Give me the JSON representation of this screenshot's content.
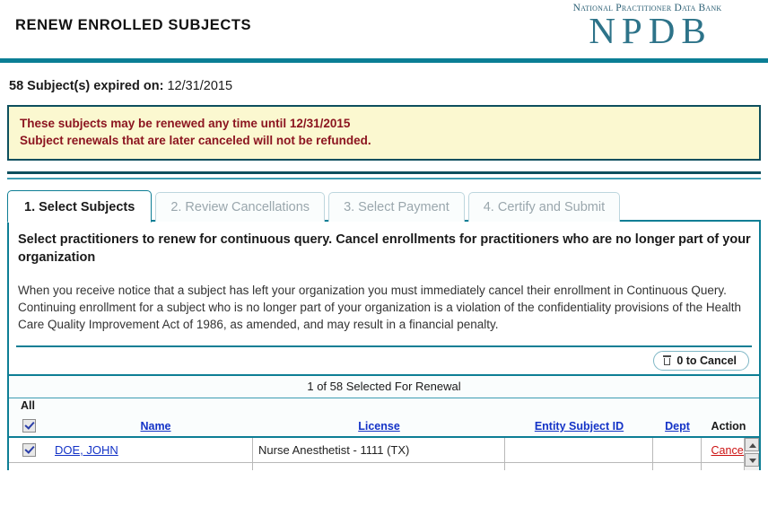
{
  "header": {
    "page_title": "RENEW ENROLLED SUBJECTS",
    "logo_subtitle": "National Practitioner Data Bank",
    "logo_main": "NPDB",
    "accent_color": "#0b7e95"
  },
  "summary": {
    "expired_label": "58 Subject(s) expired on:",
    "expired_date": "12/31/2015"
  },
  "warning": {
    "line1": "These subjects may be renewed any time until 12/31/2015",
    "line2": "Subject renewals that are later canceled will not be refunded.",
    "text_color": "#8c1520",
    "background_color": "#fbf8d0",
    "border_color": "#0d4f5e"
  },
  "tabs": [
    {
      "label": "1. Select Subjects",
      "active": true
    },
    {
      "label": "2. Review Cancellations",
      "active": false
    },
    {
      "label": "3. Select Payment",
      "active": false
    },
    {
      "label": "4. Certify and Submit",
      "active": false
    }
  ],
  "content": {
    "heading": "Select practitioners to renew for continuous query. Cancel enrollments for practitioners who are no longer part of your organization",
    "paragraph": "When you receive notice that a subject has left your organization you must immediately cancel their enrollment in Continuous Query. Continuing enrollment for a subject who is no longer part of your organization is a violation of the confidentiality provisions of the Health Care Quality Improvement Act of 1986, as amended, and may result in a financial penalty."
  },
  "toolbar": {
    "cancel_button_label": "0 to Cancel",
    "cancel_button_icon": "trash-icon"
  },
  "table": {
    "caption": "1 of 58 Selected For Renewal",
    "all_label": "All",
    "select_all_checked": true,
    "columns": [
      {
        "label": "",
        "link": false
      },
      {
        "label": "Name",
        "link": true
      },
      {
        "label": "License",
        "link": true
      },
      {
        "label": "Entity Subject ID",
        "link": true
      },
      {
        "label": "Dept",
        "link": true
      },
      {
        "label": "Action",
        "link": false
      }
    ],
    "rows": [
      {
        "checked": true,
        "name": "DOE, JOHN",
        "license": "Nurse Anesthetist - 1111 (TX)",
        "entity_subject_id": "",
        "dept": "",
        "action": "Cancel"
      }
    ],
    "link_color": "#1433c7",
    "action_color": "#cc1111"
  }
}
